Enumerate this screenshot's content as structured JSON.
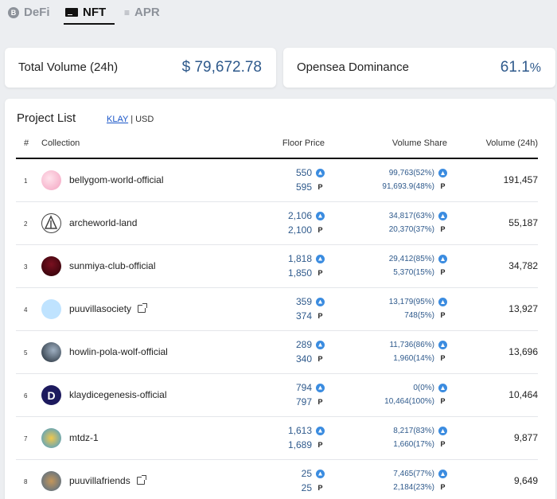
{
  "tabs": [
    {
      "label": "DeFi",
      "icon": "defi-coin-icon"
    },
    {
      "label": "NFT",
      "icon": "nft-card-icon"
    },
    {
      "label": "APR",
      "icon": "apr-list-icon"
    }
  ],
  "defi_icon_letter": "B",
  "apr_icon_glyph": "≡",
  "summary": {
    "total_volume_label": "Total Volume (24h)",
    "total_volume_value": "$ 79,672.78",
    "dominance_label": "Opensea Dominance",
    "dominance_value": "61.1",
    "dominance_unit": "%"
  },
  "project_list": {
    "title": "Project List",
    "currency_klay": "KLAY",
    "currency_separator": "|",
    "currency_usd": "USD",
    "columns": {
      "rank": "#",
      "collection": "Collection",
      "floor_price": "Floor Price",
      "volume_share": "Volume Share",
      "volume": "Volume (24h)"
    },
    "rows": [
      {
        "rank": "1",
        "name": "bellygom-world-official",
        "external": false,
        "floor_klay": "550",
        "floor_opensea": "595",
        "share_klay": "99,763(52%)",
        "share_opensea": "91,693.9(48%)",
        "volume": "191,457"
      },
      {
        "rank": "2",
        "name": "archeworld-land",
        "external": false,
        "floor_klay": "2,106",
        "floor_opensea": "2,100",
        "share_klay": "34,817(63%)",
        "share_opensea": "20,370(37%)",
        "volume": "55,187"
      },
      {
        "rank": "3",
        "name": "sunmiya-club-official",
        "external": false,
        "floor_klay": "1,818",
        "floor_opensea": "1,850",
        "share_klay": "29,412(85%)",
        "share_opensea": "5,370(15%)",
        "volume": "34,782"
      },
      {
        "rank": "4",
        "name": "puuvillasociety",
        "external": true,
        "floor_klay": "359",
        "floor_opensea": "374",
        "share_klay": "13,179(95%)",
        "share_opensea": "748(5%)",
        "volume": "13,927"
      },
      {
        "rank": "5",
        "name": "howlin-pola-wolf-official",
        "external": false,
        "floor_klay": "289",
        "floor_opensea": "340",
        "share_klay": "11,736(86%)",
        "share_opensea": "1,960(14%)",
        "volume": "13,696"
      },
      {
        "rank": "6",
        "name": "klaydicegenesis-official",
        "external": false,
        "floor_klay": "794",
        "floor_opensea": "797",
        "share_klay": "0(0%)",
        "share_opensea": "10,464(100%)",
        "volume": "10,464"
      },
      {
        "rank": "7",
        "name": "mtdz-1",
        "external": false,
        "floor_klay": "1,613",
        "floor_opensea": "1,689",
        "share_klay": "8,217(83%)",
        "share_opensea": "1,660(17%)",
        "volume": "9,877"
      },
      {
        "rank": "8",
        "name": "puuvillafriends",
        "external": true,
        "floor_klay": "25",
        "floor_opensea": "25",
        "share_klay": "7,465(77%)",
        "share_opensea": "2,184(23%)",
        "volume": "9,649"
      }
    ]
  },
  "avatar_letter_row6": "D",
  "opensea_glyph": "P",
  "colors": {
    "accent_value": "#2f5a8c",
    "link": "#1a56c8",
    "klay_badge": "#3b8ce0",
    "background": "#eceef1"
  }
}
